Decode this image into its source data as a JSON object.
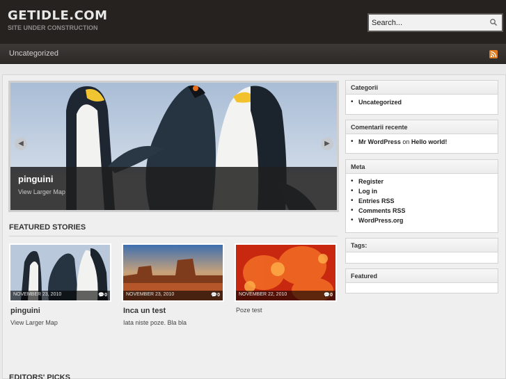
{
  "header": {
    "site_title": "GETIDLE.COM",
    "site_description": "SITE UNDER CONSTRUCTION",
    "search_placeholder": "Search...",
    "search_icon": "search-icon"
  },
  "nav": {
    "items": [
      "Uncategorized"
    ],
    "rss_icon": "rss-icon"
  },
  "slider": {
    "title": "pinguini",
    "subtitle": "View Larger Map"
  },
  "featured": {
    "heading": "FEATURED STORIES",
    "cards": [
      {
        "date": "NOVEMBER 23, 2010",
        "comments": "0",
        "title": "pinguini",
        "excerpt": "View Larger Map"
      },
      {
        "date": "NOVEMBER 23, 2010",
        "comments": "0",
        "title": "Inca un test",
        "excerpt": "Iata niste poze. Bla bla"
      },
      {
        "date": "NOVEMBER 22, 2010",
        "comments": "0",
        "title": "Poze test",
        "excerpt": ""
      }
    ]
  },
  "editors": {
    "heading": "EDITORS' PICKS"
  },
  "sidebar": {
    "categories": {
      "title": "Categorii",
      "items": [
        "Uncategorized"
      ]
    },
    "recent_comments": {
      "title": "Comentarii recente",
      "author": "Mr WordPress",
      "on": "on",
      "post": "Hello world!"
    },
    "meta": {
      "title": "Meta",
      "items": [
        "Register",
        "Log in",
        "Entries RSS",
        "Comments RSS",
        "WordPress.org"
      ]
    },
    "tags": {
      "title": "Tags:"
    },
    "featured": {
      "title": "Featured"
    }
  },
  "colors": {
    "header_bg": "#252220",
    "nav_bg": "#3c3936",
    "page_bg": "#efefef",
    "rss_orange": "#e07a1f"
  }
}
